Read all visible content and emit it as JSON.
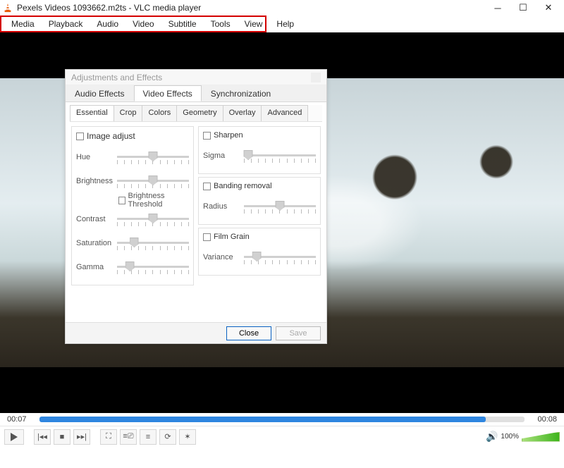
{
  "window": {
    "title": "Pexels Videos 1093662.m2ts - VLC media player"
  },
  "menu": [
    "Media",
    "Playback",
    "Audio",
    "Video",
    "Subtitle",
    "Tools",
    "View",
    "Help"
  ],
  "dialog": {
    "title": "Adjustments and Effects",
    "tabs1": [
      "Audio Effects",
      "Video Effects",
      "Synchronization"
    ],
    "tabs1_active": 1,
    "tabs2": [
      "Essential",
      "Crop",
      "Colors",
      "Geometry",
      "Overlay",
      "Advanced"
    ],
    "tabs2_active": 0,
    "left": {
      "chk": "Image adjust",
      "sliders": [
        {
          "label": "Hue",
          "pos": 50
        },
        {
          "label": "Brightness",
          "pos": 50
        },
        {
          "label": "Contrast",
          "pos": 50
        },
        {
          "label": "Saturation",
          "pos": 24
        },
        {
          "label": "Gamma",
          "pos": 18
        }
      ],
      "threshold": "Brightness Threshold"
    },
    "right_groups": [
      {
        "chk": "Sharpen",
        "slider": {
          "label": "Sigma",
          "pos": 6
        }
      },
      {
        "chk": "Banding removal",
        "slider": {
          "label": "Radius",
          "pos": 50
        }
      },
      {
        "chk": "Film Grain",
        "slider": {
          "label": "Variance",
          "pos": 18
        }
      }
    ],
    "close": "Close",
    "save": "Save"
  },
  "time_cur": "00:07",
  "time_tot": "00:08",
  "volume_pct": "100%"
}
